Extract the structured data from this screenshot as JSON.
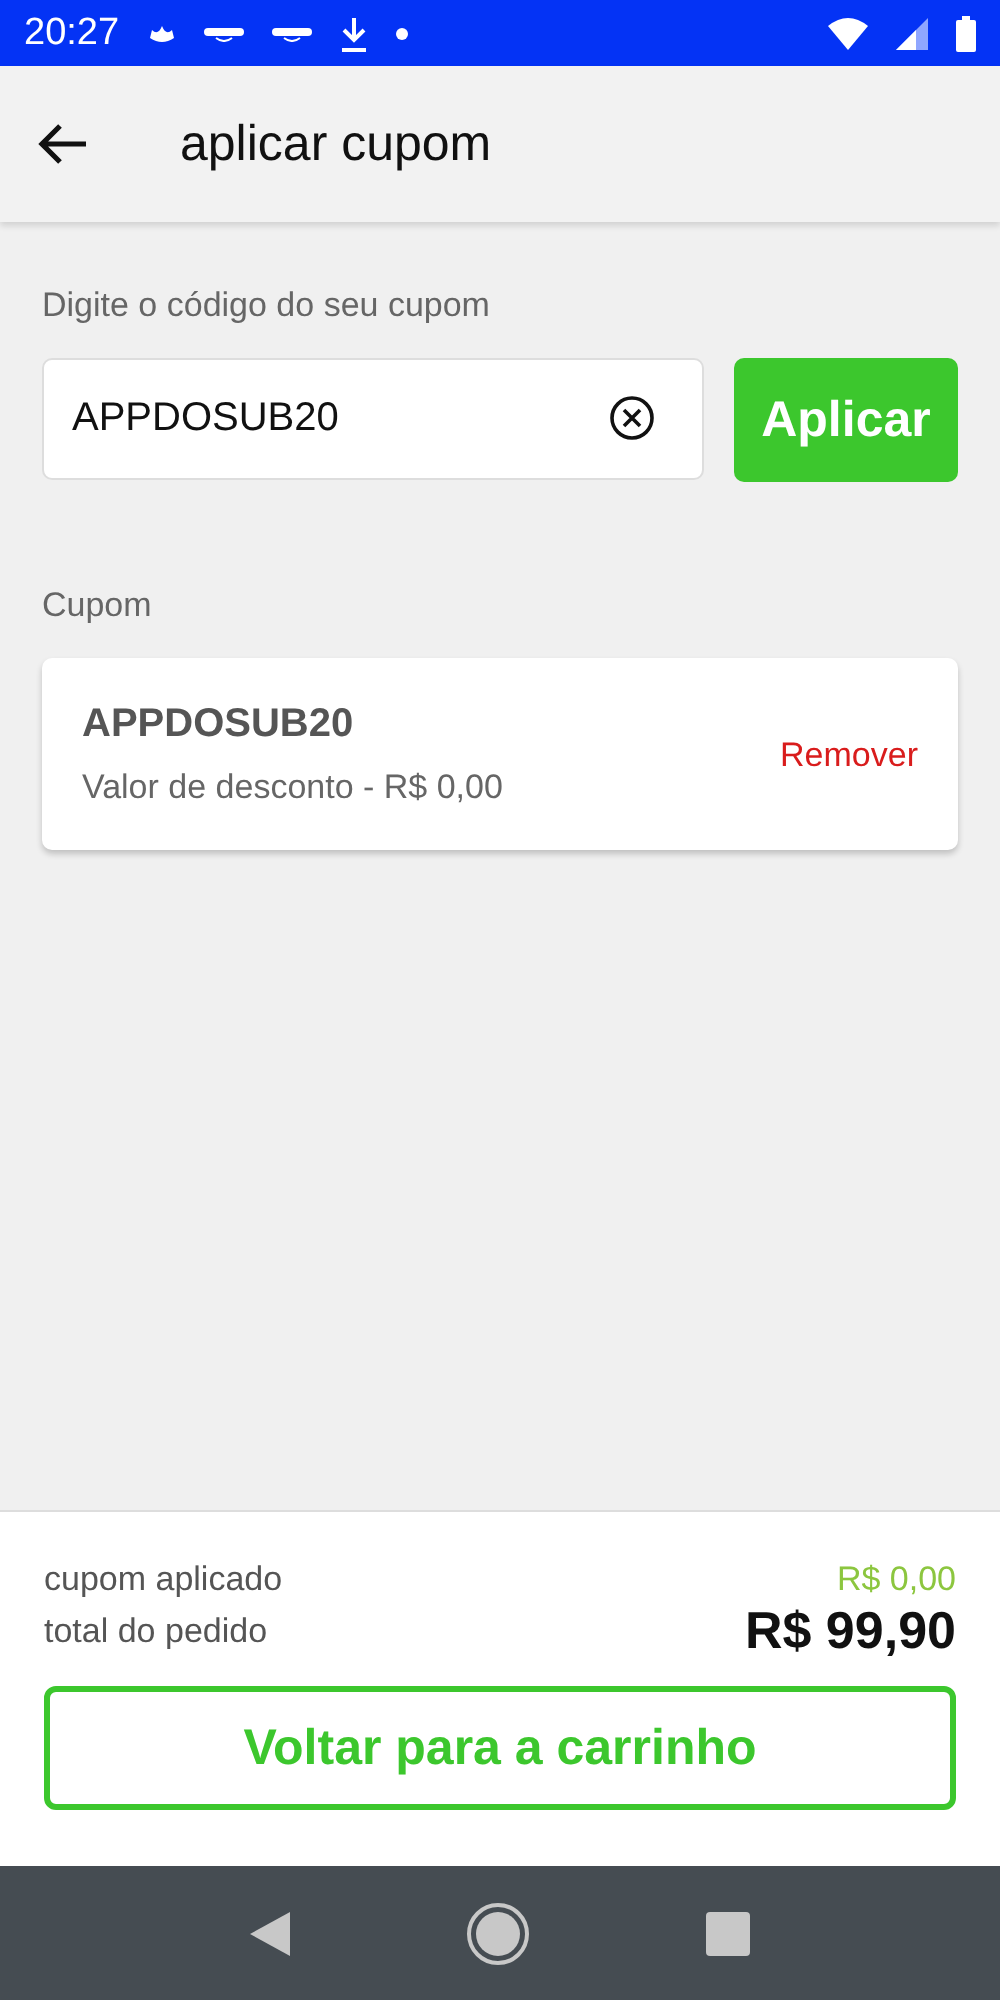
{
  "status_bar": {
    "time": "20:27"
  },
  "header": {
    "title": "aplicar cupom"
  },
  "coupon_input": {
    "label": "Digite o código do seu cupom",
    "value": "APPDOSUB20",
    "button": "Aplicar"
  },
  "applied": {
    "label": "Cupom",
    "code": "APPDOSUB20",
    "discount": "Valor de desconto - R$ 0,00",
    "remove": "Remover"
  },
  "summary": {
    "rows": [
      {
        "label": "cupom aplicado",
        "value": "R$ 0,00",
        "kind": "discount"
      },
      {
        "label": "total do pedido",
        "value": "R$ 99,90",
        "kind": "total"
      }
    ],
    "button": "Voltar para a carrinho"
  }
}
